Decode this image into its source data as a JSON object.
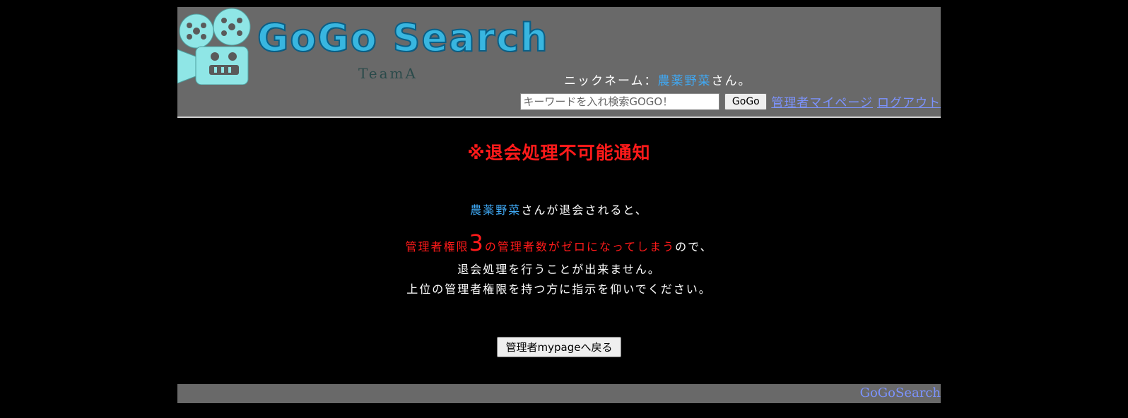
{
  "header": {
    "logo_text": "GoGo Search",
    "logo_subtitle": "TeamA",
    "nickname_label": "ニックネーム：",
    "nickname": "農薬野菜",
    "nickname_suffix": "さん。",
    "search_placeholder": "キーワードを入れ検索GOGO！",
    "search_button": "GoGo",
    "admin_mypage_link": "管理者マイページ",
    "logout_link": "ログアウト"
  },
  "main": {
    "title": "※退会処理不可能通知",
    "line1_name": "農薬野菜",
    "line1_rest": "さんが退会されると、",
    "line2_red_a": "管理者権限",
    "line2_level": "3",
    "line2_red_b": "の管理者数がゼロになってしまう",
    "line2_rest": "ので、",
    "line3": "退会処理を行うことが出来ません。",
    "line4": "上位の管理者権限を持つ方に指示を仰いでください。",
    "back_button": "管理者mypageへ戻る"
  },
  "footer": {
    "link": "GoGoSearch"
  },
  "colors": {
    "header_bg": "#696969",
    "logo_cyan": "#38b6e0",
    "alert_red": "#ff1a1a",
    "name_blue": "#3fa9f5",
    "link_blue": "#7c93ff"
  }
}
